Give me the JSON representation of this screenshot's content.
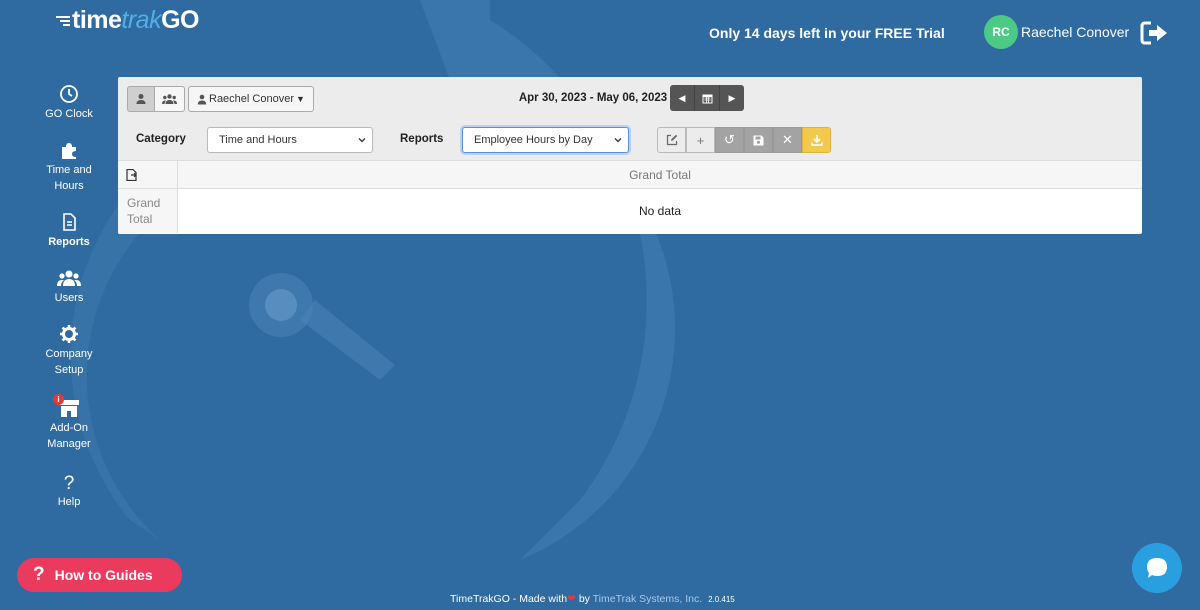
{
  "brand": {
    "logo_prefix": "time",
    "logo_middle": "trak",
    "logo_suffix": "GO"
  },
  "header": {
    "trial_text": "Only 14 days left in your FREE Trial",
    "avatar_initials": "RC",
    "user_name": "Raechel Conover",
    "logout_icon": "logout-icon"
  },
  "sidebar": {
    "items": [
      {
        "label": "GO Clock",
        "icon": "clock-icon"
      },
      {
        "label": "Time and Hours",
        "icon": "puzzle-icon"
      },
      {
        "label": "Reports",
        "icon": "document-icon",
        "active": true
      },
      {
        "label": "Users",
        "icon": "users-icon"
      },
      {
        "label": "Company Setup",
        "icon": "gear-icon"
      },
      {
        "label": "Add-On Manager",
        "icon": "store-icon",
        "badge": "i"
      },
      {
        "label": "Help",
        "icon": "question-icon"
      }
    ]
  },
  "toolbar": {
    "employee_selector": "Raechel Conover",
    "date_range": "Apr 30, 2023 - May 06, 2023",
    "category_label": "Category",
    "category_value": "Time and Hours",
    "reports_label": "Reports",
    "reports_value": "Employee Hours by Day"
  },
  "grid": {
    "column_header": "Grand Total",
    "row_header": "Grand Total",
    "empty_text": "No data"
  },
  "footer": {
    "guides_label": "How to Guides",
    "made_with_prefix": "TimeTrakGO - Made with",
    "made_with_by": "by",
    "company": "TimeTrak Systems, Inc.",
    "version": "2.0.415"
  },
  "colors": {
    "background": "#2f6aa0",
    "accent_green": "#4cc985",
    "guides_pink": "#ea3b5f",
    "export_gold": "#f2c94c",
    "chat_blue": "#2a9fe0"
  }
}
